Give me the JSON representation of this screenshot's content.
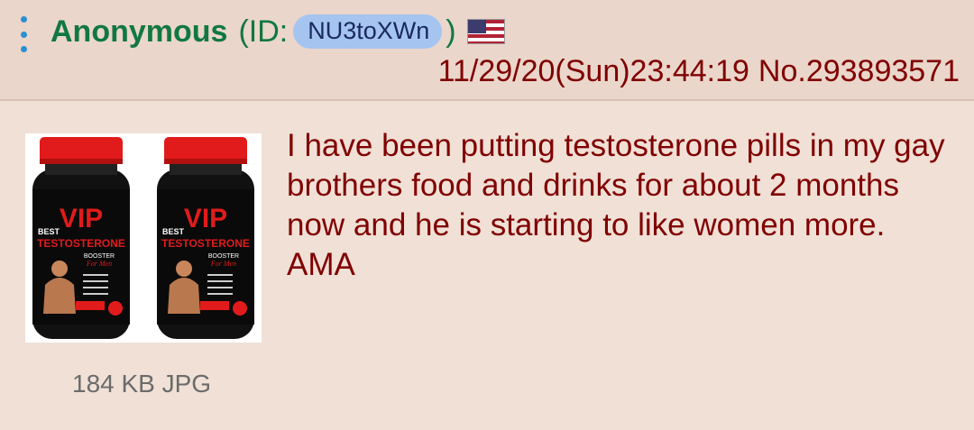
{
  "post": {
    "name": "Anonymous",
    "id_open": "(ID:",
    "id": "NU3toXWn",
    "id_close": ")",
    "flag": "us-flag-icon",
    "datetime": "11/29/20(Sun)23:44:19",
    "post_number": "No.293893571",
    "comment": "I have been putting testosterone pills in my gay brothers food and drinks for about 2 months now and he is starting to like women more. AMA",
    "file_info": "184 KB JPG"
  },
  "image": {
    "bottles": [
      {
        "brand": "VIP",
        "line1": "BEST",
        "line2": "TESTOSTERONE",
        "line3": "BOOSTER",
        "line4": "For Men"
      },
      {
        "brand": "VIP",
        "line1": "BEST",
        "line2": "TESTOSTERONE",
        "line3": "BOOSTER",
        "line4": "For Men"
      }
    ]
  },
  "colors": {
    "background": "#f0e0d6",
    "header": "#ead6ca",
    "name": "#117743",
    "text": "#800000",
    "id_badge": "#a6c4f0",
    "menu_dots": "#2a8fd0",
    "cap_red": "#e11b1b"
  }
}
